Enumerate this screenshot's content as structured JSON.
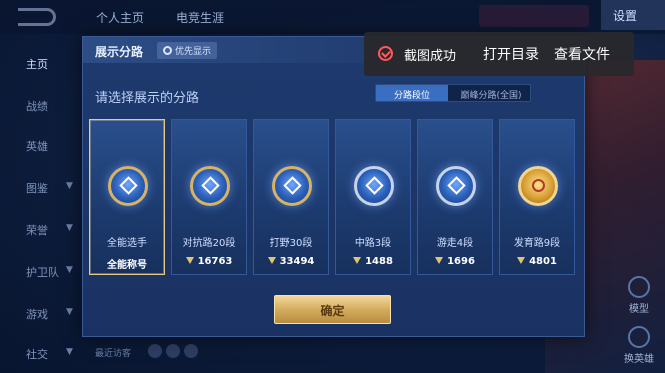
{
  "top_tabs": [
    "个人主页",
    "电竞生涯"
  ],
  "settings_label": "设置",
  "sidebar": {
    "items": [
      {
        "label": "主页",
        "active": true
      },
      {
        "label": "战绩"
      },
      {
        "label": "英雄"
      },
      {
        "label": "图鉴",
        "chevron": true
      },
      {
        "label": "荣誉",
        "chevron": true
      },
      {
        "label": "护卫队",
        "chevron": true
      },
      {
        "label": "游戏",
        "chevron": true
      },
      {
        "label": "社交",
        "chevron": true
      }
    ]
  },
  "right_buttons": [
    "模型",
    "换英雄"
  ],
  "visitor_label": "最近访客",
  "modal": {
    "title": "展示分路",
    "priority_label": "优先显示",
    "prompt": "请选择展示的分路",
    "toggle": {
      "active": "分路段位",
      "inactive": "巅峰分路(全国)"
    },
    "cards": [
      {
        "label": "全能选手",
        "value": "全能称号",
        "selected": true,
        "icon": "all-round-icon",
        "tier": "gold-border"
      },
      {
        "label": "对抗路20段",
        "value": "16763",
        "icon": "clash-lane-icon",
        "tier": "gold-border"
      },
      {
        "label": "打野30段",
        "value": "33494",
        "icon": "jungle-icon",
        "tier": "gold-border"
      },
      {
        "label": "中路3段",
        "value": "1488",
        "icon": "mid-lane-icon",
        "tier": "silver"
      },
      {
        "label": "游走4段",
        "value": "1696",
        "icon": "roam-icon",
        "tier": "silver"
      },
      {
        "label": "发育路9段",
        "value": "4801",
        "icon": "farm-lane-icon",
        "tier": "gold"
      }
    ],
    "confirm_label": "确定"
  },
  "toast": {
    "message": "截图成功",
    "open_dir": "打开目录",
    "view_file": "查看文件",
    "accent": "#ff5a5a"
  }
}
